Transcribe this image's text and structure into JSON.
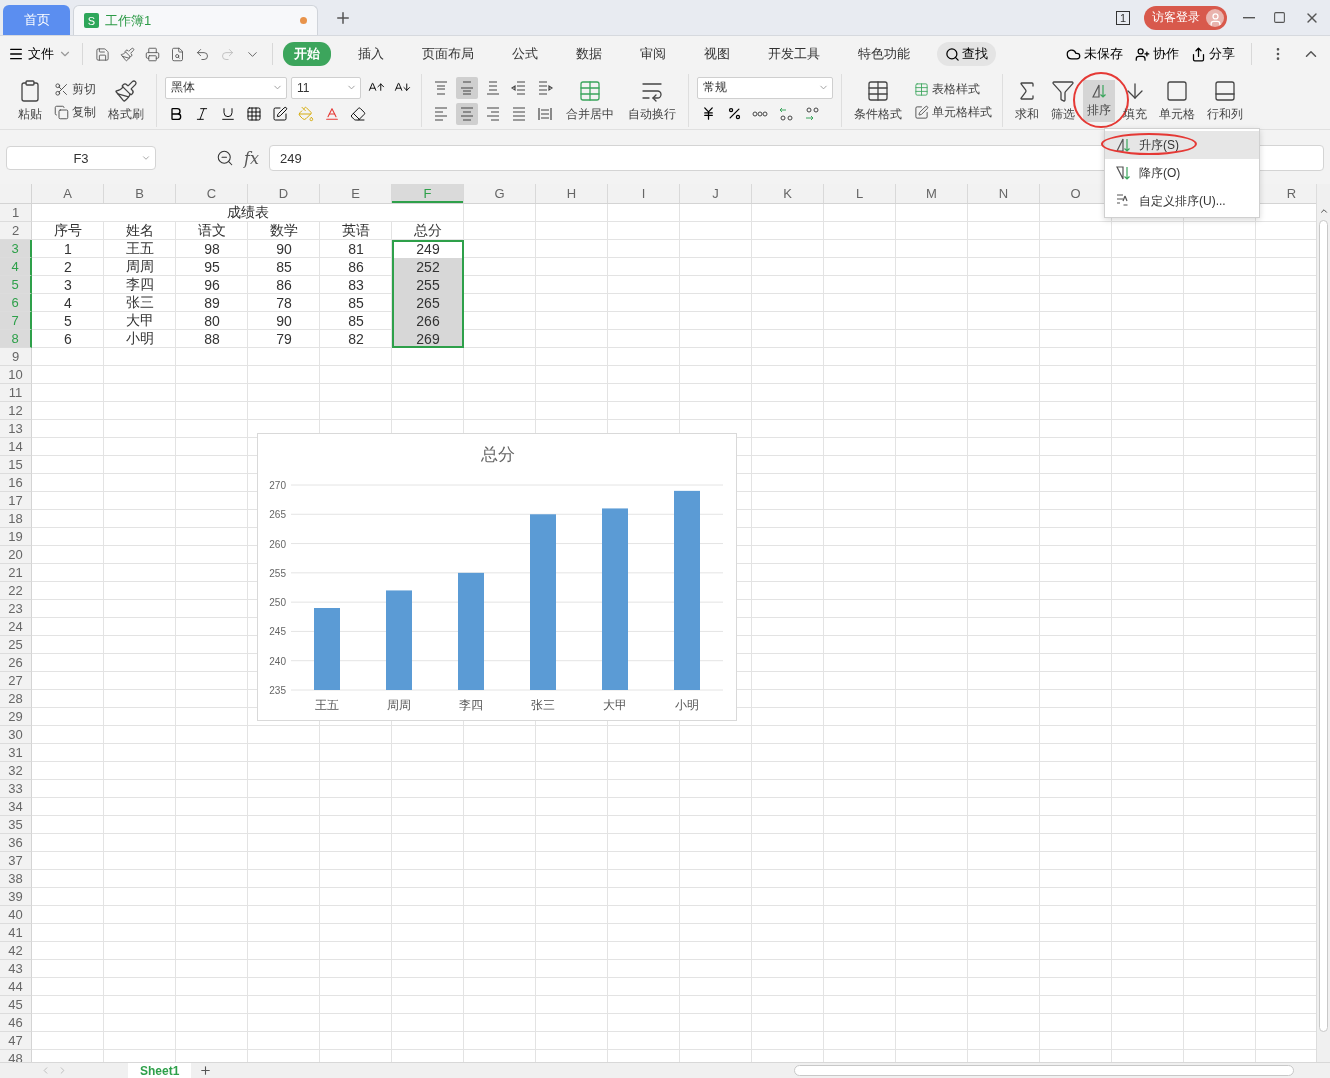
{
  "tabs": [
    {
      "kind": "home",
      "label": "首页",
      "selected": false
    },
    {
      "kind": "doc",
      "label": "工作簿1",
      "icon_letter": "S",
      "unsaved": true,
      "selected": true
    }
  ],
  "window_count": "1",
  "login": "访客登录",
  "menu": {
    "file": "文件",
    "tabs": [
      {
        "label": "开始",
        "selected": true
      },
      {
        "label": "插入",
        "selected": false
      },
      {
        "label": "页面布局",
        "selected": false
      },
      {
        "label": "公式",
        "selected": false
      },
      {
        "label": "数据",
        "selected": false
      },
      {
        "label": "审阅",
        "selected": false
      },
      {
        "label": "视图",
        "selected": false
      },
      {
        "label": "开发工具",
        "selected": false
      },
      {
        "label": "特色功能",
        "selected": false
      }
    ],
    "search": "查找",
    "actions": [
      "未保存",
      "协作",
      "分享"
    ]
  },
  "ribbon": {
    "paste": "粘贴",
    "cut": "剪切",
    "copy": "复制",
    "format_painter": "格式刷",
    "font_name": "黑体",
    "font_size": "11",
    "align_buttons": [
      {
        "selected": false
      },
      {
        "selected": true
      },
      {
        "selected": false
      },
      {
        "selected": false
      },
      {
        "selected": false
      },
      {
        "selected": false
      },
      {
        "selected": true
      },
      {
        "selected": false
      },
      {
        "selected": false
      },
      {
        "selected": false
      }
    ],
    "merge": "合并居中",
    "wrap": "自动换行",
    "number_format": "常规",
    "conditional": "条件格式",
    "table_style": "表格样式",
    "cell_style": "单元格样式",
    "tools": [
      {
        "label": "求和",
        "selected": false,
        "annotated": false
      },
      {
        "label": "筛选",
        "selected": false,
        "annotated": false
      },
      {
        "label": "排序",
        "selected": true,
        "annotated": true
      },
      {
        "label": "填充",
        "selected": false,
        "annotated": false
      },
      {
        "label": "单元格",
        "selected": false,
        "annotated": false
      },
      {
        "label": "行和列",
        "selected": false,
        "annotated": false
      }
    ]
  },
  "sort_menu": [
    {
      "label": "升序(S)",
      "selected": true,
      "annotated": true
    },
    {
      "label": "降序(O)",
      "selected": false,
      "annotated": false
    },
    {
      "label": "自定义排序(U)...",
      "selected": false,
      "annotated": false
    }
  ],
  "formula_bar": {
    "name_box": "F3",
    "fx_label": "fx",
    "value": "249"
  },
  "columns": [
    {
      "label": "A",
      "selected": false
    },
    {
      "label": "B",
      "selected": false
    },
    {
      "label": "C",
      "selected": false
    },
    {
      "label": "D",
      "selected": false
    },
    {
      "label": "E",
      "selected": false
    },
    {
      "label": "F",
      "selected": true
    },
    {
      "label": "G",
      "selected": false
    },
    {
      "label": "H",
      "selected": false
    },
    {
      "label": "I",
      "selected": false
    },
    {
      "label": "J",
      "selected": false
    },
    {
      "label": "K",
      "selected": false
    },
    {
      "label": "L",
      "selected": false
    },
    {
      "label": "M",
      "selected": false
    },
    {
      "label": "N",
      "selected": false
    },
    {
      "label": "O",
      "selected": false
    }
  ],
  "last_column": {
    "label": "R",
    "selected": false
  },
  "rows": [
    {
      "number": "1",
      "selected": false,
      "title": "成绩表"
    },
    {
      "number": "2",
      "selected": false,
      "cells": [
        "序号",
        "姓名",
        "语文",
        "数学",
        "英语",
        "总分"
      ]
    },
    {
      "number": "3",
      "selected": true,
      "cells": [
        "1",
        "王五",
        "98",
        "90",
        "81",
        "249"
      ]
    },
    {
      "number": "4",
      "selected": true,
      "cells": [
        "2",
        "周周",
        "95",
        "85",
        "86",
        "252"
      ]
    },
    {
      "number": "5",
      "selected": true,
      "cells": [
        "3",
        "李四",
        "96",
        "86",
        "83",
        "255"
      ]
    },
    {
      "number": "6",
      "selected": true,
      "cells": [
        "4",
        "张三",
        "89",
        "78",
        "85",
        "265"
      ]
    },
    {
      "number": "7",
      "selected": true,
      "cells": [
        "5",
        "大甲",
        "80",
        "90",
        "85",
        "266"
      ]
    },
    {
      "number": "8",
      "selected": true,
      "cells": [
        "6",
        "小明",
        "88",
        "79",
        "82",
        "269"
      ]
    },
    {
      "number": "9",
      "selected": false
    },
    {
      "number": "10",
      "selected": false
    },
    {
      "number": "11",
      "selected": false
    },
    {
      "number": "12",
      "selected": false
    },
    {
      "number": "13",
      "selected": false
    },
    {
      "number": "14",
      "selected": false
    },
    {
      "number": "15",
      "selected": false
    },
    {
      "number": "16",
      "selected": false
    },
    {
      "number": "17",
      "selected": false
    },
    {
      "number": "18",
      "selected": false
    },
    {
      "number": "19",
      "selected": false
    },
    {
      "number": "20",
      "selected": false
    },
    {
      "number": "21",
      "selected": false
    },
    {
      "number": "22",
      "selected": false
    },
    {
      "number": "23",
      "selected": false
    },
    {
      "number": "24",
      "selected": false
    },
    {
      "number": "25",
      "selected": false
    },
    {
      "number": "26",
      "selected": false
    },
    {
      "number": "27",
      "selected": false
    },
    {
      "number": "28",
      "selected": false
    },
    {
      "number": "29",
      "selected": false
    },
    {
      "number": "30",
      "selected": false
    },
    {
      "number": "31",
      "selected": false
    },
    {
      "number": "32",
      "selected": false
    },
    {
      "number": "33",
      "selected": false
    },
    {
      "number": "34",
      "selected": false
    },
    {
      "number": "35",
      "selected": false
    },
    {
      "number": "36",
      "selected": false
    },
    {
      "number": "37",
      "selected": false
    },
    {
      "number": "38",
      "selected": false
    },
    {
      "number": "39",
      "selected": false
    },
    {
      "number": "40",
      "selected": false
    },
    {
      "number": "41",
      "selected": false
    },
    {
      "number": "42",
      "selected": false
    },
    {
      "number": "43",
      "selected": false
    },
    {
      "number": "44",
      "selected": false
    },
    {
      "number": "45",
      "selected": false
    },
    {
      "number": "46",
      "selected": false
    },
    {
      "number": "47",
      "selected": false
    },
    {
      "number": "48",
      "selected": false
    }
  ],
  "chart": {
    "chart_data": {
      "type": "bar",
      "title": "总分",
      "grid": true,
      "categories": [
        "王五",
        "周周",
        "李四",
        "张三",
        "大甲",
        "小明"
      ],
      "series": [
        {
          "color": "#5b9bd5",
          "values": [
            249,
            252,
            255,
            265,
            266,
            269
          ]
        }
      ],
      "ylim": [
        235,
        270
      ],
      "yticks": [
        235,
        240,
        245,
        250,
        255,
        260,
        265,
        270
      ]
    }
  },
  "sheets": [
    {
      "label": "Sheet1",
      "selected": true
    }
  ]
}
